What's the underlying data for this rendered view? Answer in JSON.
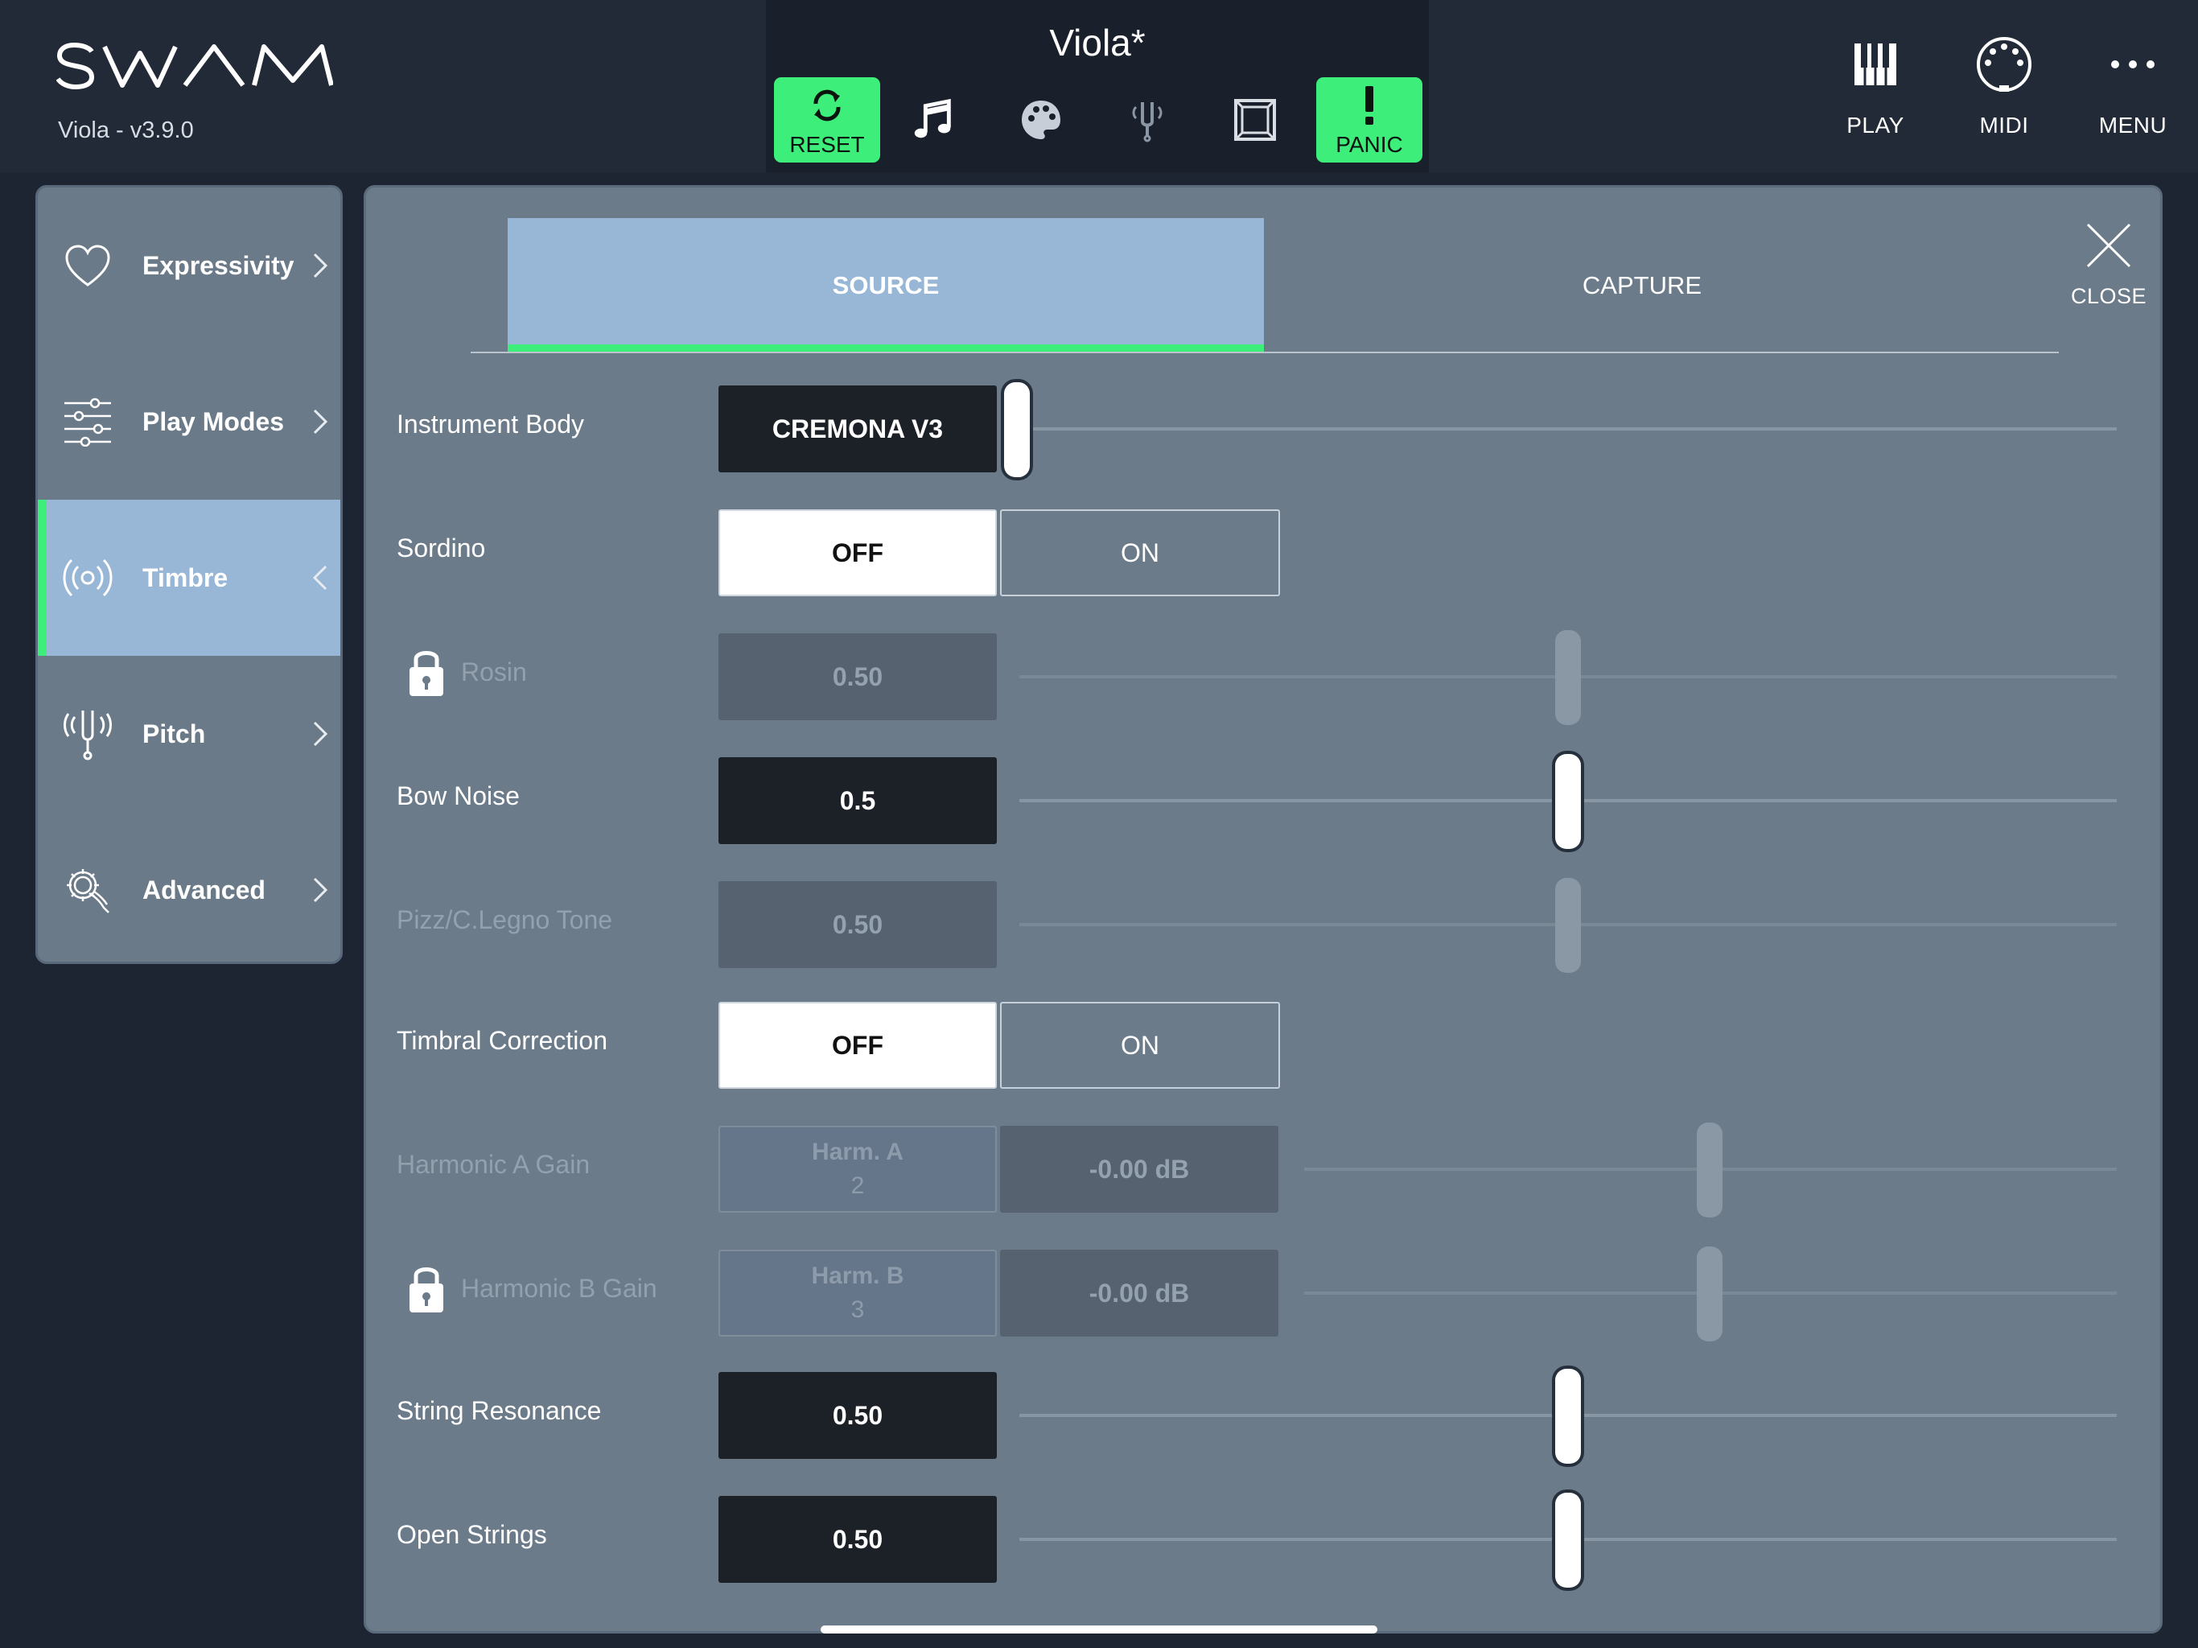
{
  "app": {
    "logo": "SWAM",
    "version": "Viola - v3.9.0",
    "preset_name": "Viola*"
  },
  "toolbar": {
    "reset_label": "RESET",
    "panic_label": "PANIC",
    "accent": "#3dee7a"
  },
  "topright": {
    "play_label": "PLAY",
    "midi_label": "MIDI",
    "menu_label": "MENU"
  },
  "sidebar": {
    "items": [
      {
        "label": "Expressivity",
        "icon": "heart-icon"
      },
      {
        "label": "Play Modes",
        "icon": "sliders-icon"
      },
      {
        "label": "Timbre",
        "icon": "broadcast-icon",
        "active": true
      },
      {
        "label": "Pitch",
        "icon": "tuning-fork-icon"
      },
      {
        "label": "Advanced",
        "icon": "gear-hand-icon"
      }
    ]
  },
  "tabs": {
    "source": "SOURCE",
    "capture": "CAPTURE",
    "close": "CLOSE"
  },
  "params": {
    "instrument_body": {
      "label": "Instrument Body",
      "value": "CREMONA V3",
      "slider": 0.0
    },
    "sordino": {
      "label": "Sordino",
      "off": "OFF",
      "on": "ON",
      "selected": "OFF"
    },
    "rosin": {
      "label": "Rosin",
      "value": "0.50",
      "slider": 0.5,
      "locked": true
    },
    "bow_noise": {
      "label": "Bow Noise",
      "value": "0.5",
      "slider": 0.5
    },
    "pizz": {
      "label": "Pizz/C.Legno Tone",
      "value": "0.50",
      "slider": 0.5
    },
    "timbral_correction": {
      "label": "Timbral Correction",
      "off": "OFF",
      "on": "ON",
      "selected": "OFF"
    },
    "harmonic_a": {
      "label": "Harmonic A Gain",
      "harm_title": "Harm. A",
      "harm_num": "2",
      "value": "-0.00 dB",
      "slider": 0.5
    },
    "harmonic_b": {
      "label": "Harmonic B Gain",
      "harm_title": "Harm. B",
      "harm_num": "3",
      "value": "-0.00 dB",
      "slider": 0.5,
      "locked": true
    },
    "string_resonance": {
      "label": "String Resonance",
      "value": "0.50",
      "slider": 0.5
    },
    "open_strings": {
      "label": "Open Strings",
      "value": "0.50",
      "slider": 0.5
    }
  }
}
